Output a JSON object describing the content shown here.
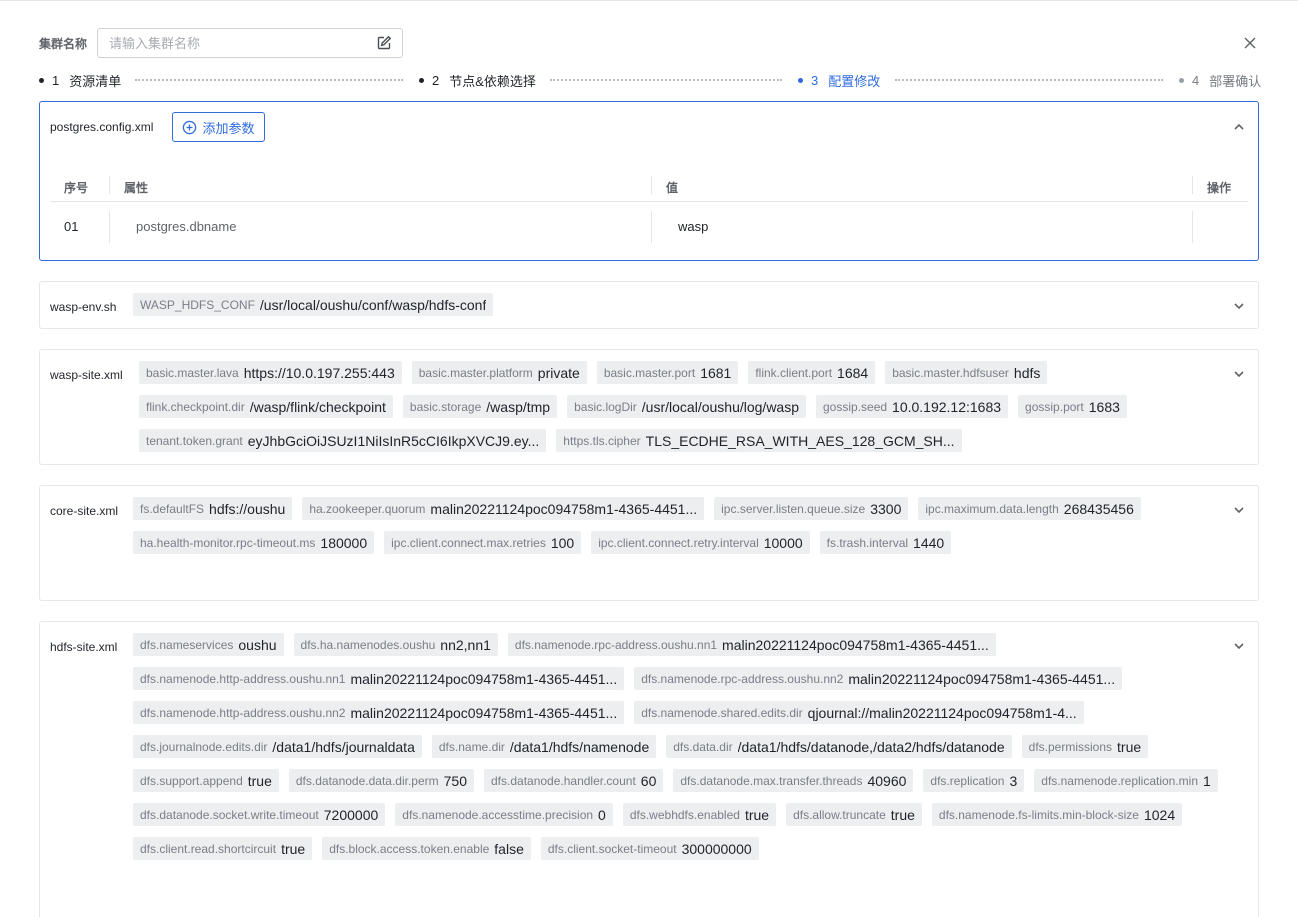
{
  "header": {
    "name_label": "集群名称",
    "name_placeholder": "请输入集群名称"
  },
  "steps": [
    {
      "num": "1",
      "label": "资源清单",
      "state": "done"
    },
    {
      "num": "2",
      "label": "节点&依赖选择",
      "state": "done"
    },
    {
      "num": "3",
      "label": "配置修改",
      "state": "active"
    },
    {
      "num": "4",
      "label": "部署确认",
      "state": "future"
    }
  ],
  "postgres": {
    "title": "postgres.config.xml",
    "add_label": "添加参数",
    "columns": {
      "index": "序号",
      "property": "属性",
      "value": "值",
      "action": "操作"
    },
    "rows": [
      {
        "index": "01",
        "property": "postgres.dbname",
        "value": "wasp"
      }
    ]
  },
  "panels": [
    {
      "title": "wasp-env.sh",
      "items": [
        {
          "k": "WASP_HDFS_CONF",
          "v": "/usr/local/oushu/conf/wasp/hdfs-conf"
        }
      ]
    },
    {
      "title": "wasp-site.xml",
      "items": [
        {
          "k": "basic.master.lava",
          "v": "https://10.0.197.255:443"
        },
        {
          "k": "basic.master.platform",
          "v": "private"
        },
        {
          "k": "basic.master.port",
          "v": "1681"
        },
        {
          "k": "flink.client.port",
          "v": "1684"
        },
        {
          "k": "basic.master.hdfsuser",
          "v": "hdfs"
        },
        {
          "k": "flink.checkpoint.dir",
          "v": "/wasp/flink/checkpoint"
        },
        {
          "k": "basic.storage",
          "v": "/wasp/tmp"
        },
        {
          "k": "basic.logDir",
          "v": "/usr/local/oushu/log/wasp"
        },
        {
          "k": "gossip.seed",
          "v": "10.0.192.12:1683"
        },
        {
          "k": "gossip.port",
          "v": "1683"
        },
        {
          "k": "tenant.token.grant",
          "v": "eyJhbGciOiJSUzI1NiIsInR5cCI6IkpXVCJ9.ey..."
        },
        {
          "k": "https.tls.cipher",
          "v": "TLS_ECDHE_RSA_WITH_AES_128_GCM_SH..."
        }
      ]
    },
    {
      "title": "core-site.xml",
      "items": [
        {
          "k": "fs.defaultFS",
          "v": "hdfs://oushu"
        },
        {
          "k": "ha.zookeeper.quorum",
          "v": "malin20221124poc094758m1-4365-4451..."
        },
        {
          "k": "ipc.server.listen.queue.size",
          "v": "3300"
        },
        {
          "k": "ipc.maximum.data.length",
          "v": "268435456"
        },
        {
          "k": "ha.health-monitor.rpc-timeout.ms",
          "v": "180000"
        },
        {
          "k": "ipc.client.connect.max.retries",
          "v": "100"
        },
        {
          "k": "ipc.client.connect.retry.interval",
          "v": "10000"
        },
        {
          "k": "fs.trash.interval",
          "v": "1440"
        }
      ]
    },
    {
      "title": "hdfs-site.xml",
      "items": [
        {
          "k": "dfs.nameservices",
          "v": "oushu"
        },
        {
          "k": "dfs.ha.namenodes.oushu",
          "v": "nn2,nn1"
        },
        {
          "k": "dfs.namenode.rpc-address.oushu.nn1",
          "v": "malin20221124poc094758m1-4365-4451..."
        },
        {
          "k": "dfs.namenode.http-address.oushu.nn1",
          "v": "malin20221124poc094758m1-4365-4451..."
        },
        {
          "k": "dfs.namenode.rpc-address.oushu.nn2",
          "v": "malin20221124poc094758m1-4365-4451..."
        },
        {
          "k": "dfs.namenode.http-address.oushu.nn2",
          "v": "malin20221124poc094758m1-4365-4451..."
        },
        {
          "k": "dfs.namenode.shared.edits.dir",
          "v": "qjournal://malin20221124poc094758m1-4..."
        },
        {
          "k": "dfs.journalnode.edits.dir",
          "v": "/data1/hdfs/journaldata"
        },
        {
          "k": "dfs.name.dir",
          "v": "/data1/hdfs/namenode"
        },
        {
          "k": "dfs.data.dir",
          "v": "/data1/hdfs/datanode,/data2/hdfs/datanode"
        },
        {
          "k": "dfs.permissions",
          "v": "true"
        },
        {
          "k": "dfs.support.append",
          "v": "true"
        },
        {
          "k": "dfs.datanode.data.dir.perm",
          "v": "750"
        },
        {
          "k": "dfs.datanode.handler.count",
          "v": "60"
        },
        {
          "k": "dfs.datanode.max.transfer.threads",
          "v": "40960"
        },
        {
          "k": "dfs.replication",
          "v": "3"
        },
        {
          "k": "dfs.namenode.replication.min",
          "v": "1"
        },
        {
          "k": "dfs.datanode.socket.write.timeout",
          "v": "7200000"
        },
        {
          "k": "dfs.namenode.accesstime.precision",
          "v": "0"
        },
        {
          "k": "dfs.webhdfs.enabled",
          "v": "true"
        },
        {
          "k": "dfs.allow.truncate",
          "v": "true"
        },
        {
          "k": "dfs.namenode.fs-limits.min-block-size",
          "v": "1024"
        },
        {
          "k": "dfs.client.read.shortcircuit",
          "v": "true"
        },
        {
          "k": "dfs.block.access.token.enable",
          "v": "false"
        },
        {
          "k": "dfs.client.socket-timeout",
          "v": "300000000"
        }
      ]
    }
  ]
}
